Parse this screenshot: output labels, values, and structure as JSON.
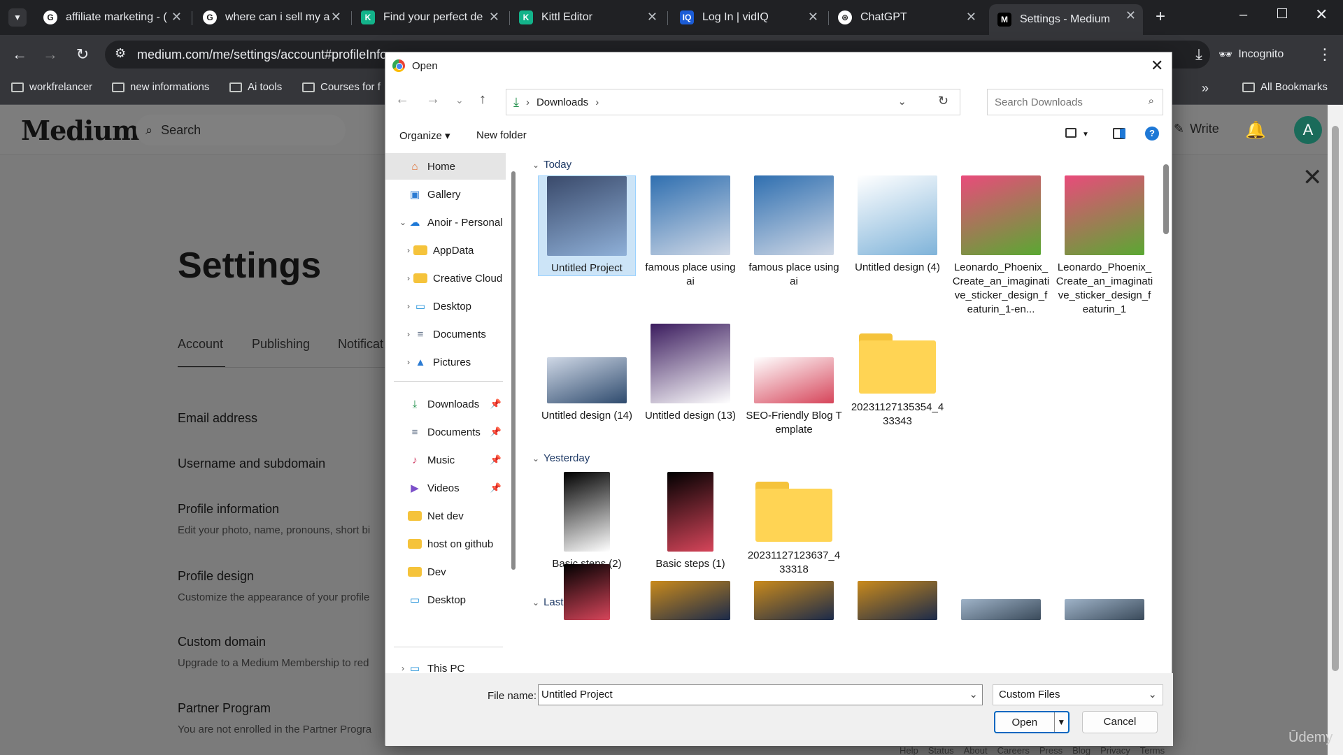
{
  "browser": {
    "tabs": [
      {
        "title": "affiliate marketing - (",
        "favicon": "G",
        "color": "#ffffff"
      },
      {
        "title": "where can i sell my ai",
        "favicon": "G",
        "color": "#ffffff"
      },
      {
        "title": "Find your perfect de",
        "favicon": "K",
        "color": "#13b38a"
      },
      {
        "title": "Kittl Editor",
        "favicon": "K",
        "color": "#13b38a"
      },
      {
        "title": "Log In | vidIQ",
        "favicon": "IQ",
        "color": "#1b5cd6"
      },
      {
        "title": "ChatGPT",
        "favicon": "⊛",
        "color": "#ffffff"
      },
      {
        "title": "Settings - Medium",
        "favicon": "M",
        "color": "#000000"
      }
    ],
    "url": "medium.com/me/settings/account#profileInfo",
    "incognito_label": "Incognito",
    "bookmarks": [
      "workfrelancer",
      "new informations",
      "Ai tools",
      "Courses for f"
    ],
    "all_bookmarks": "All Bookmarks"
  },
  "medium": {
    "logo": "Medium",
    "search": "Search",
    "write": "Write",
    "avatar": "A",
    "settings_title": "Settings",
    "tabs": [
      "Account",
      "Publishing",
      "Notificat"
    ],
    "rows": [
      {
        "title": "Email address",
        "sub": ""
      },
      {
        "title": "Username and subdomain",
        "sub": ""
      },
      {
        "title": "Profile information",
        "sub": "Edit your photo, name, pronouns, short bi"
      },
      {
        "title": "Profile design",
        "sub": "Customize the appearance of your profile"
      },
      {
        "title": "Custom domain",
        "sub": "Upgrade to a Medium Membership to red"
      },
      {
        "title": "Partner Program",
        "sub": "You are not enrolled in the Partner Progra"
      }
    ],
    "footer": [
      "Help",
      "Status",
      "About",
      "Careers",
      "Press",
      "Blog",
      "Privacy",
      "Terms"
    ],
    "watermark": "Ūdemy"
  },
  "dialog": {
    "title": "Open",
    "location": "Downloads",
    "search_placeholder": "Search Downloads",
    "organize": "Organize ▾",
    "new_folder": "New folder",
    "nav": [
      {
        "label": "Home",
        "icon": "home",
        "color": "#e06b2d",
        "level": 0
      },
      {
        "label": "Gallery",
        "icon": "gallery",
        "color": "#2b7bd3",
        "level": 0
      },
      {
        "label": "Anoir - Personal",
        "icon": "cloud",
        "color": "#1e78d6",
        "level": 0,
        "expanded": true
      },
      {
        "label": "AppData",
        "icon": "folder",
        "color": "#f5c33b",
        "level": 1
      },
      {
        "label": "Creative Cloud",
        "icon": "folder",
        "color": "#f5c33b",
        "level": 1
      },
      {
        "label": "Desktop",
        "icon": "desktop",
        "color": "#1c8fd8",
        "level": 1
      },
      {
        "label": "Documents",
        "icon": "doc",
        "color": "#6b7a8f",
        "level": 1
      },
      {
        "label": "Pictures",
        "icon": "pictures",
        "color": "#2b7bd3",
        "level": 1
      }
    ],
    "quick": [
      {
        "label": "Downloads",
        "icon": "download",
        "color": "#1f8f4a",
        "pinned": true
      },
      {
        "label": "Documents",
        "icon": "doc",
        "color": "#6b7a8f",
        "pinned": true
      },
      {
        "label": "Music",
        "icon": "music",
        "color": "#d2466b",
        "pinned": true
      },
      {
        "label": "Videos",
        "icon": "video",
        "color": "#7b4fc9",
        "pinned": true
      },
      {
        "label": "Net dev",
        "icon": "folder",
        "color": "#f5c33b",
        "pinned": false
      },
      {
        "label": "host on github",
        "icon": "folder",
        "color": "#f5c33b",
        "pinned": false
      },
      {
        "label": "Dev",
        "icon": "folder",
        "color": "#f5c33b",
        "pinned": false
      },
      {
        "label": "Desktop",
        "icon": "desktop",
        "color": "#1c8fd8",
        "pinned": false
      }
    ],
    "this_pc": "This PC",
    "groups": {
      "today": "Today",
      "yesterday": "Yesterday",
      "last_week": "Last week"
    },
    "files_today": [
      {
        "name": "Untitled Project",
        "kind": "image",
        "colors": [
          "#3a4a6b",
          "#8fb0d8"
        ],
        "selected": true
      },
      {
        "name": "famous place using ai",
        "kind": "image",
        "colors": [
          "#2f6fb0",
          "#cfd8e6"
        ]
      },
      {
        "name": "famous place using ai",
        "kind": "image",
        "colors": [
          "#2f6fb0",
          "#cfd8e6"
        ]
      },
      {
        "name": "Untitled design (4)",
        "kind": "image",
        "colors": [
          "#ffffff",
          "#7fb3d9"
        ]
      },
      {
        "name": "Leonardo_Phoenix_Create_an_imaginative_sticker_design_featurin_1-en...",
        "kind": "image",
        "colors": [
          "#e94b7b",
          "#5aa832"
        ]
      },
      {
        "name": "Leonardo_Phoenix_Create_an_imaginative_sticker_design_featurin_1",
        "kind": "image",
        "colors": [
          "#e94b7b",
          "#5aa832"
        ]
      },
      {
        "name": "Untitled design (14)",
        "kind": "image",
        "colors": [
          "#cfd8e6",
          "#2f4b6e"
        ]
      },
      {
        "name": "Untitled design (13)",
        "kind": "image",
        "colors": [
          "#3b1c5e",
          "#ffffff"
        ]
      },
      {
        "name": "SEO-Friendly Blog Template",
        "kind": "image",
        "colors": [
          "#ffffff",
          "#d6455a"
        ]
      },
      {
        "name": "20231127135354_433343",
        "kind": "folder"
      }
    ],
    "files_yesterday": [
      {
        "name": "Basic steps (2)",
        "kind": "image",
        "colors": [
          "#000000",
          "#ffffff"
        ]
      },
      {
        "name": "Basic steps (1)",
        "kind": "image",
        "colors": [
          "#000000",
          "#d6455a"
        ]
      },
      {
        "name": "20231127123637_433318",
        "kind": "folder"
      }
    ],
    "files_lastweek": [
      {
        "kind": "image",
        "colors": [
          "#000000",
          "#d6455a"
        ]
      },
      {
        "kind": "image",
        "colors": [
          "#c98a1c",
          "#1b2a4a"
        ]
      },
      {
        "kind": "image",
        "colors": [
          "#c98a1c",
          "#1b2a4a"
        ]
      },
      {
        "kind": "image",
        "colors": [
          "#c98a1c",
          "#1b2a4a"
        ]
      },
      {
        "kind": "image",
        "colors": [
          "#9fb3c8",
          "#3a4a5a"
        ]
      },
      {
        "kind": "image",
        "colors": [
          "#9fb3c8",
          "#3a4a5a"
        ]
      }
    ],
    "file_name_label": "File name:",
    "file_name_value": "Untitled Project",
    "file_type": "Custom Files",
    "open_label": "Open",
    "cancel_label": "Cancel"
  }
}
